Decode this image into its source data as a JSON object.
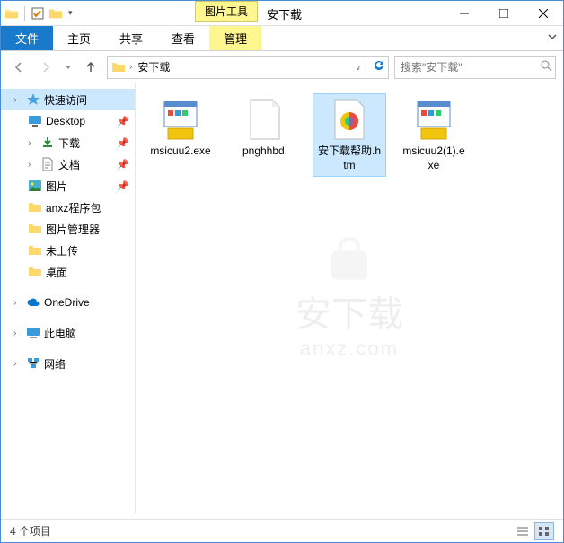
{
  "titlebar": {
    "contextual_tab": "图片工具",
    "window_title": "安下载"
  },
  "ribbon": {
    "file": "文件",
    "home": "主页",
    "share": "共享",
    "view": "查看",
    "manage": "管理"
  },
  "address": {
    "current": "安下载",
    "search_placeholder": "搜索\"安下载\""
  },
  "sidebar": {
    "quick_access": "快速访问",
    "items": [
      {
        "label": "Desktop"
      },
      {
        "label": "下载"
      },
      {
        "label": "文档"
      },
      {
        "label": "图片"
      },
      {
        "label": "anxz程序包"
      },
      {
        "label": "图片管理器"
      },
      {
        "label": "未上传"
      },
      {
        "label": "桌面"
      }
    ],
    "onedrive": "OneDrive",
    "this_pc": "此电脑",
    "network": "网络"
  },
  "files": [
    {
      "name": "msicuu2.exe",
      "type": "exe"
    },
    {
      "name": "pnghhbd.",
      "type": "blank"
    },
    {
      "name": "安下载帮助.htm",
      "type": "htm"
    },
    {
      "name": "msicuu2(1).exe",
      "type": "exe"
    }
  ],
  "watermark": {
    "text": "安下载",
    "sub": "anxz.com"
  },
  "status": {
    "text": "4 个项目"
  }
}
